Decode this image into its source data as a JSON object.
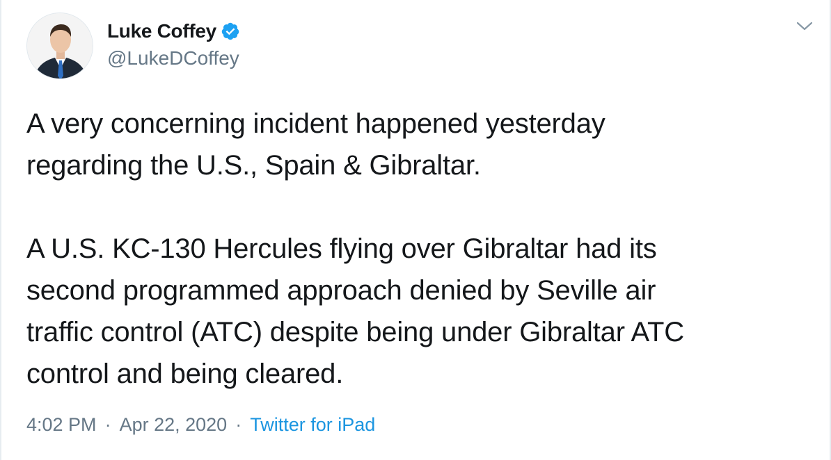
{
  "author": {
    "display_name": "Luke Coffey",
    "handle": "@LukeDCoffey",
    "verified_icon": "verified-badge-icon",
    "avatar_icon": "profile-photo-avatar"
  },
  "tweet": {
    "paragraph_1": "A very concerning incident happened yesterday\nregarding the U.S., Spain & Gibraltar.",
    "paragraph_2": "A U.S. KC-130 Hercules flying over Gibraltar had its\nsecond programmed approach denied by Seville air\ntraffic control (ATC) despite being under Gibraltar ATC\ncontrol and being cleared."
  },
  "meta": {
    "time": "4:02 PM",
    "separator": "·",
    "date": "Apr 22, 2020",
    "source": "Twitter for iPad"
  },
  "menu": {
    "icon": "chevron-down-icon"
  },
  "colors": {
    "verified_blue": "#1da1f2",
    "link_blue": "#1b95e0",
    "secondary_text": "#657786",
    "primary_text": "#14171a"
  }
}
